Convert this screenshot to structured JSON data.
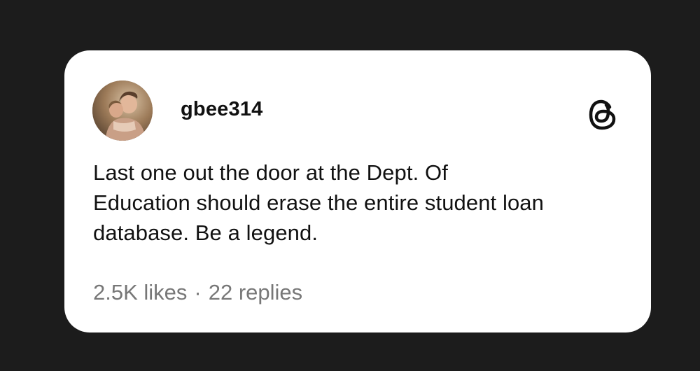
{
  "post": {
    "username": "gbee314",
    "text_lines": [
      "Last one out the door at the Dept. Of",
      "Education should erase the entire student loan",
      "database. Be a legend."
    ],
    "likes": "2.5K likes",
    "separator": "·",
    "replies": "22 replies"
  },
  "icons": {
    "brand": "threads-logo-icon",
    "avatar": "profile-photo"
  },
  "colors": {
    "background": "#1c1c1c",
    "card": "#ffffff",
    "text": "#111111",
    "muted": "#777777"
  }
}
